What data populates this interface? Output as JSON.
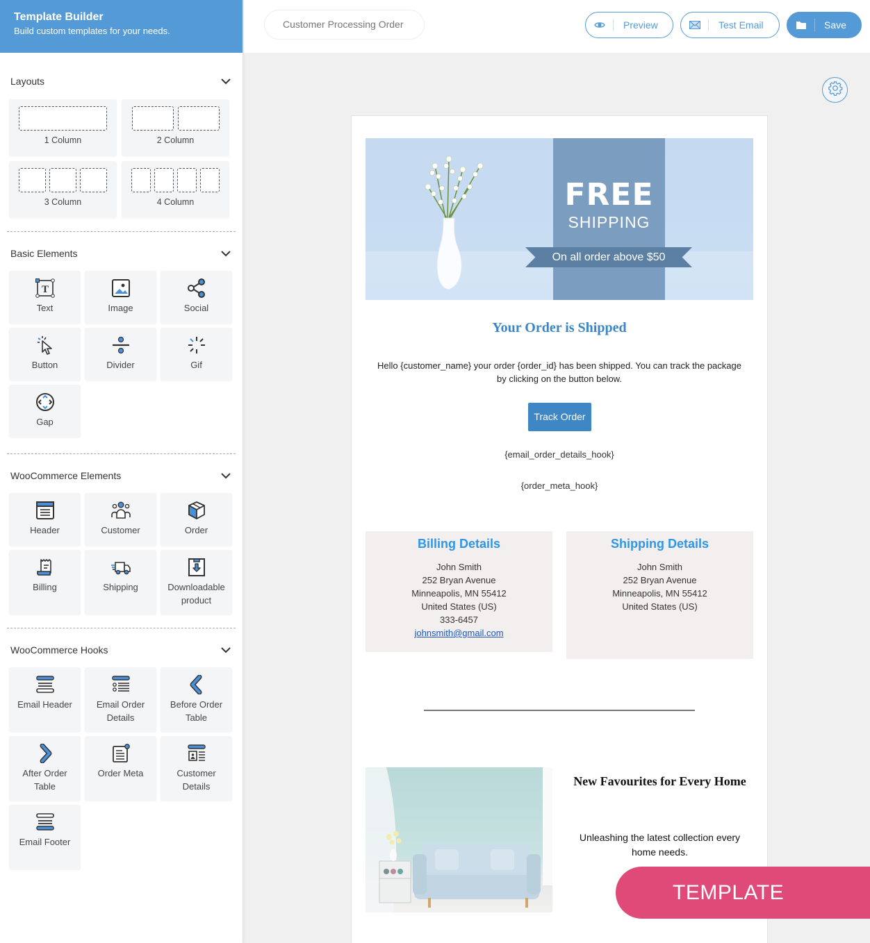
{
  "brand": {
    "title": "Template Builder",
    "subtitle": "Build custom templates for your needs.",
    "accent_color": "#549ad6"
  },
  "topbar": {
    "template_name": "Customer Processing Order",
    "preview_label": "Preview",
    "test_email_label": "Test Email",
    "save_label": "Save"
  },
  "sidebar": {
    "layouts": {
      "title": "Layouts",
      "items": [
        {
          "label": "1 Column",
          "columns": 1
        },
        {
          "label": "2 Column",
          "columns": 2
        },
        {
          "label": "3 Column",
          "columns": 3
        },
        {
          "label": "4 Column",
          "columns": 4
        }
      ]
    },
    "basic": {
      "title": "Basic Elements",
      "items": [
        {
          "label": "Text",
          "icon": "text-icon"
        },
        {
          "label": "Image",
          "icon": "image-icon"
        },
        {
          "label": "Social",
          "icon": "share-icon"
        },
        {
          "label": "Button",
          "icon": "cursor-click-icon"
        },
        {
          "label": "Divider",
          "icon": "divider-icon"
        },
        {
          "label": "Gif",
          "icon": "loader-icon"
        },
        {
          "label": "Gap",
          "icon": "gap-icon"
        }
      ]
    },
    "woo_elements": {
      "title": "WooCommerce Elements",
      "items": [
        {
          "label": "Header",
          "icon": "header-icon"
        },
        {
          "label": "Customer",
          "icon": "users-icon"
        },
        {
          "label": "Order",
          "icon": "box-icon"
        },
        {
          "label": "Billing",
          "icon": "receipt-icon"
        },
        {
          "label": "Shipping",
          "icon": "truck-icon"
        },
        {
          "label": "Downloadable product",
          "icon": "download-box-icon"
        }
      ]
    },
    "woo_hooks": {
      "title": "WooCommerce Hooks",
      "items": [
        {
          "label": "Email Header",
          "icon": "email-header-icon"
        },
        {
          "label": "Email Order Details",
          "icon": "list-icon"
        },
        {
          "label": "Before Order Table",
          "icon": "chevron-left-icon"
        },
        {
          "label": "After Order Table",
          "icon": "chevron-right-icon"
        },
        {
          "label": "Order Meta",
          "icon": "document-icon"
        },
        {
          "label": "Customer Details",
          "icon": "id-card-icon"
        },
        {
          "label": "Email Footer",
          "icon": "email-footer-icon"
        }
      ]
    }
  },
  "email": {
    "banner": {
      "headline": "FREE",
      "subhead": "SHIPPING",
      "ribbon": "On all order above $50"
    },
    "title": "Your Order is Shipped",
    "body": "Hello {customer_name} your order {order_id} has been shipped. You can track the package by clicking on the button below.",
    "button_label": "Track Order",
    "hook_order_details": "{email_order_details_hook}",
    "hook_order_meta": "{order_meta_hook}",
    "billing": {
      "title": "Billing Details",
      "name": "John Smith",
      "street": "252 Bryan Avenue",
      "city": "Minneapolis, MN 55412",
      "country": "United States (US)",
      "phone": "333-6457",
      "email": "johnsmith@gmail.com"
    },
    "shipping": {
      "title": "Shipping Details",
      "name": "John Smith",
      "street": "252 Bryan Avenue",
      "city": "Minneapolis, MN 55412",
      "country": "United States (US)"
    },
    "promo": {
      "title": "New Favourites for Every Home",
      "text": "Unleashing the latest collection every home needs."
    }
  },
  "badge": {
    "label": "TEMPLATE BUILDER",
    "color": "#e04a78"
  }
}
